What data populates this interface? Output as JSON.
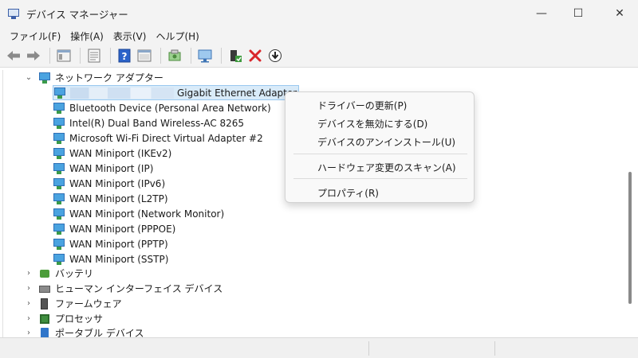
{
  "window": {
    "title": "デバイス マネージャー",
    "minimize": "—",
    "maximize": "☐",
    "close": "✕"
  },
  "menubar": [
    "ファイル(F)",
    "操作(A)",
    "表示(V)",
    "ヘルプ(H)"
  ],
  "toolbar": [
    "back-icon",
    "forward-icon",
    "properties-sheet-icon",
    "list-icon",
    "help-icon",
    "show-hidden-icon",
    "scan-hardware-icon",
    "monitor-icon",
    "enable-device-icon",
    "uninstall-device-icon",
    "update-driver-icon"
  ],
  "tree": {
    "category_network": "ネットワーク アダプター",
    "network_items": [
      "Gigabit Ethernet Adapter",
      "Bluetooth Device (Personal Area Network)",
      "Intel(R) Dual Band Wireless-AC 8265",
      "Microsoft Wi-Fi Direct Virtual Adapter #2",
      "WAN Miniport (IKEv2)",
      "WAN Miniport (IP)",
      "WAN Miniport (IPv6)",
      "WAN Miniport (L2TP)",
      "WAN Miniport (Network Monitor)",
      "WAN Miniport (PPPOE)",
      "WAN Miniport (PPTP)",
      "WAN Miniport (SSTP)"
    ],
    "other_categories": [
      "バッテリ",
      "ヒューマン インターフェイス デバイス",
      "ファームウェア",
      "プロセッサ",
      "ポータブル デバイス"
    ]
  },
  "context_menu": {
    "update_driver": "ドライバーの更新(P)",
    "disable_device": "デバイスを無効にする(D)",
    "uninstall_device": "デバイスのアンインストール(U)",
    "scan_changes": "ハードウェア変更のスキャン(A)",
    "properties": "プロパティ(R)"
  },
  "colors": {
    "selection": "#d9ebf9",
    "delete_red": "#d9262b",
    "help_blue": "#2b62c9"
  }
}
